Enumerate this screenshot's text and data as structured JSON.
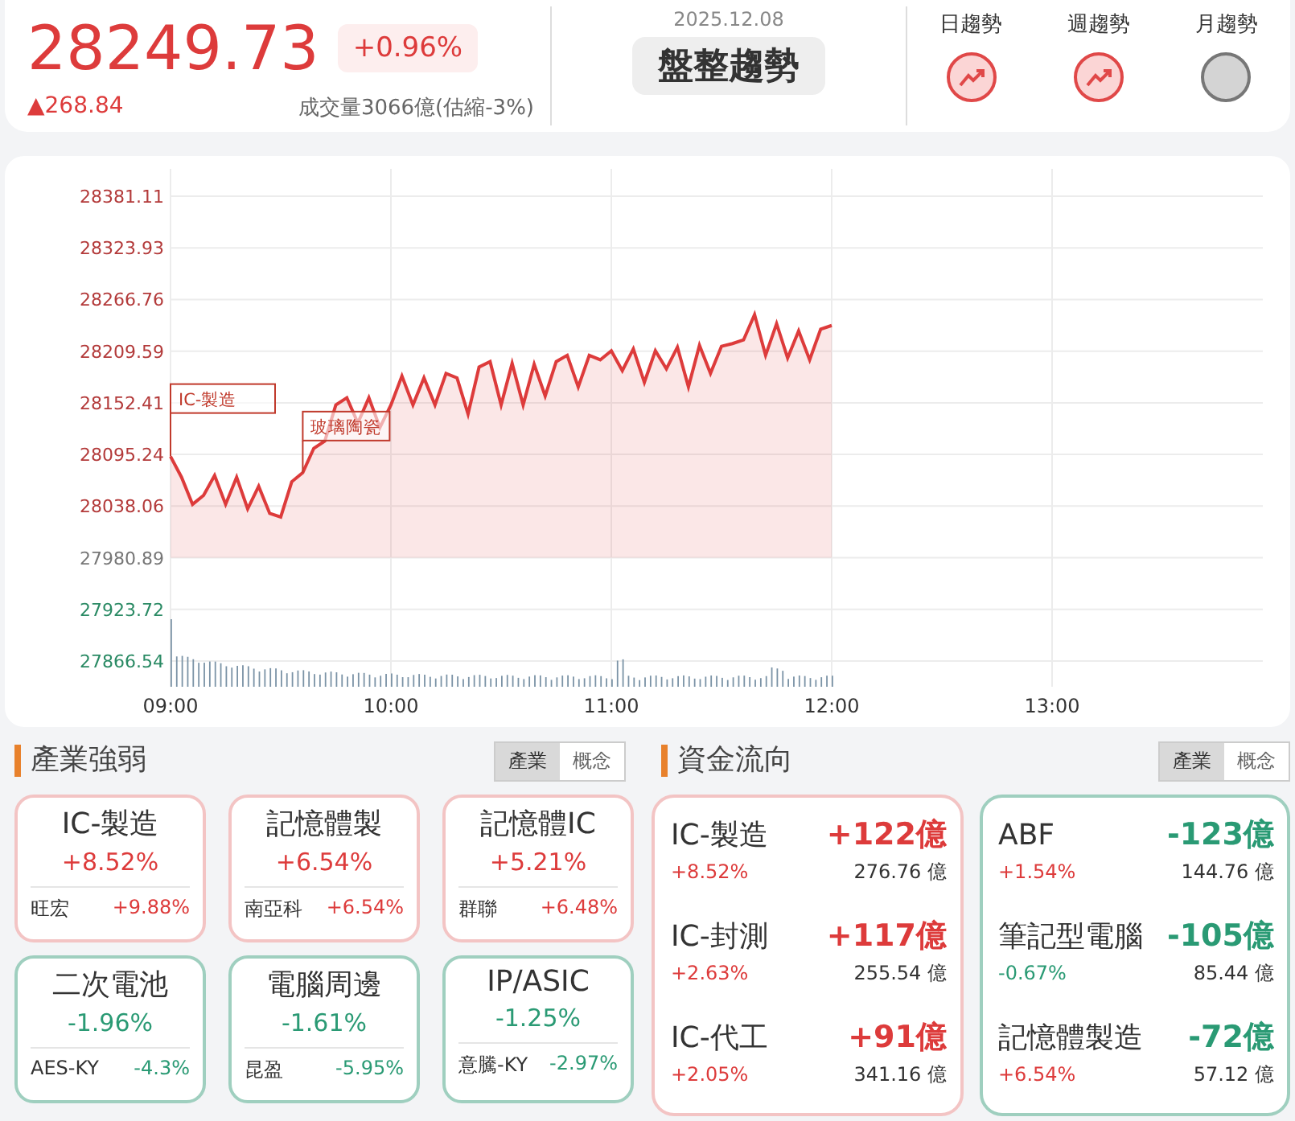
{
  "summary": {
    "price": "28249.73",
    "change_percent": "+0.96%",
    "change": "▲268.84",
    "volume": "成交量3066億(估縮-3%)",
    "date": "2025.12.08",
    "status": "盤整趨勢",
    "trends": [
      {
        "label": "日趨勢",
        "kind": "up"
      },
      {
        "label": "週趨勢",
        "kind": "up"
      },
      {
        "label": "月趨勢",
        "kind": "none"
      }
    ]
  },
  "chart": {
    "chart_data": {
      "type": "area",
      "categories": [
        "09:00",
        null,
        null,
        null,
        null,
        null,
        null,
        null,
        null,
        null,
        null,
        null,
        null,
        null,
        null,
        null,
        null,
        null,
        null,
        null,
        "10:00",
        null,
        null,
        null,
        null,
        null,
        null,
        null,
        null,
        null,
        null,
        null,
        null,
        null,
        null,
        null,
        null,
        null,
        null,
        null,
        "11:00",
        null,
        null,
        null,
        null,
        null,
        null,
        null,
        null,
        null,
        null,
        null,
        null,
        null,
        null,
        null,
        null,
        null,
        null,
        null,
        "12:00",
        null,
        null,
        null,
        null,
        null,
        null,
        null,
        null,
        null,
        null,
        null,
        null,
        null,
        null,
        null,
        null,
        null,
        null,
        null,
        "13:00"
      ],
      "series": [
        {
          "color": "#dd3b3b",
          "values": [
            28093,
            28070,
            28040,
            28050,
            28072,
            28040,
            28070,
            28035,
            28060,
            28030,
            28026,
            28065,
            28075,
            28102,
            28110,
            28150,
            28158,
            28130,
            28158,
            28125,
            28150,
            28182,
            28150,
            28180,
            28150,
            28185,
            28180,
            28140,
            28192,
            28198,
            28150,
            28196,
            28150,
            28195,
            28160,
            28198,
            28205,
            28170,
            28205,
            28200,
            28210,
            28188,
            28212,
            28175,
            28210,
            28190,
            28214,
            28170,
            28216,
            28185,
            28215,
            28218,
            28222,
            28250,
            28205,
            28240,
            28202,
            28232,
            28200,
            28234,
            28238,
            null,
            null,
            null,
            null,
            null,
            null,
            null,
            null,
            null,
            null,
            null,
            null,
            null,
            null,
            null,
            null,
            null,
            null,
            null,
            null
          ]
        }
      ],
      "ylim": [
        27866.54,
        28381.11
      ],
      "grid": true,
      "yticks": [
        28381.11,
        28323.93,
        28266.76,
        28209.59,
        28152.41,
        28095.24,
        28038.06,
        27980.89,
        27923.72,
        27866.54
      ],
      "annotations": [
        {
          "x": "09:00",
          "y": 28093,
          "text": "IC-製造"
        },
        "玻璃陶瓷"
      ]
    }
  },
  "sectors": {
    "title": "產業強弱",
    "tabs": [
      {
        "label": "產業",
        "selected": true
      },
      {
        "label": "概念",
        "selected": false
      }
    ],
    "cards": [
      {
        "name": "IC-製造",
        "percent": "+8.52%",
        "stock": "旺宏",
        "stock_percent": "+9.88%",
        "kind": "up"
      },
      {
        "name": "記憶體製",
        "percent": "+6.54%",
        "stock": "南亞科",
        "stock_percent": "+6.54%",
        "kind": "up"
      },
      {
        "name": "記憶體IC",
        "percent": "+5.21%",
        "stock": "群聯",
        "stock_percent": "+6.48%",
        "kind": "up"
      },
      {
        "name": "二次電池",
        "percent": "-1.96%",
        "stock": "AES-KY",
        "stock_percent": "-4.3%",
        "kind": "down"
      },
      {
        "name": "電腦周邊",
        "percent": "-1.61%",
        "stock": "昆盈",
        "stock_percent": "-5.95%",
        "kind": "down"
      },
      {
        "name": "IP/ASIC",
        "percent": "-1.25%",
        "stock": "意騰-KY",
        "stock_percent": "-2.97%",
        "kind": "down"
      }
    ]
  },
  "fund_flow": {
    "title": "資金流向",
    "tabs": [
      {
        "label": "產業",
        "selected": true
      },
      {
        "label": "概念",
        "selected": false
      }
    ],
    "groups": [
      {
        "kind": "up",
        "items": [
          {
            "name": "IC-製造",
            "amount": "+122億",
            "percent": "+8.52%",
            "falling": false,
            "value": "276.76 億"
          },
          {
            "name": "IC-封測",
            "amount": "+117億",
            "percent": "+2.63%",
            "falling": false,
            "value": "255.54 億"
          },
          {
            "name": "IC-代工",
            "amount": "+91億",
            "percent": "+2.05%",
            "falling": false,
            "value": "341.16 億"
          }
        ]
      },
      {
        "kind": "down",
        "items": [
          {
            "name": "ABF",
            "amount": "-123億",
            "percent": "+1.54%",
            "falling": false,
            "value": "144.76 億"
          },
          {
            "name": "筆記型電腦",
            "amount": "-105億",
            "percent": "-0.67%",
            "falling": true,
            "value": "85.44 億"
          },
          {
            "name": "記憶體製造",
            "amount": "-72億",
            "percent": "+6.54%",
            "falling": false,
            "value": "57.12 億"
          }
        ]
      }
    ]
  }
}
